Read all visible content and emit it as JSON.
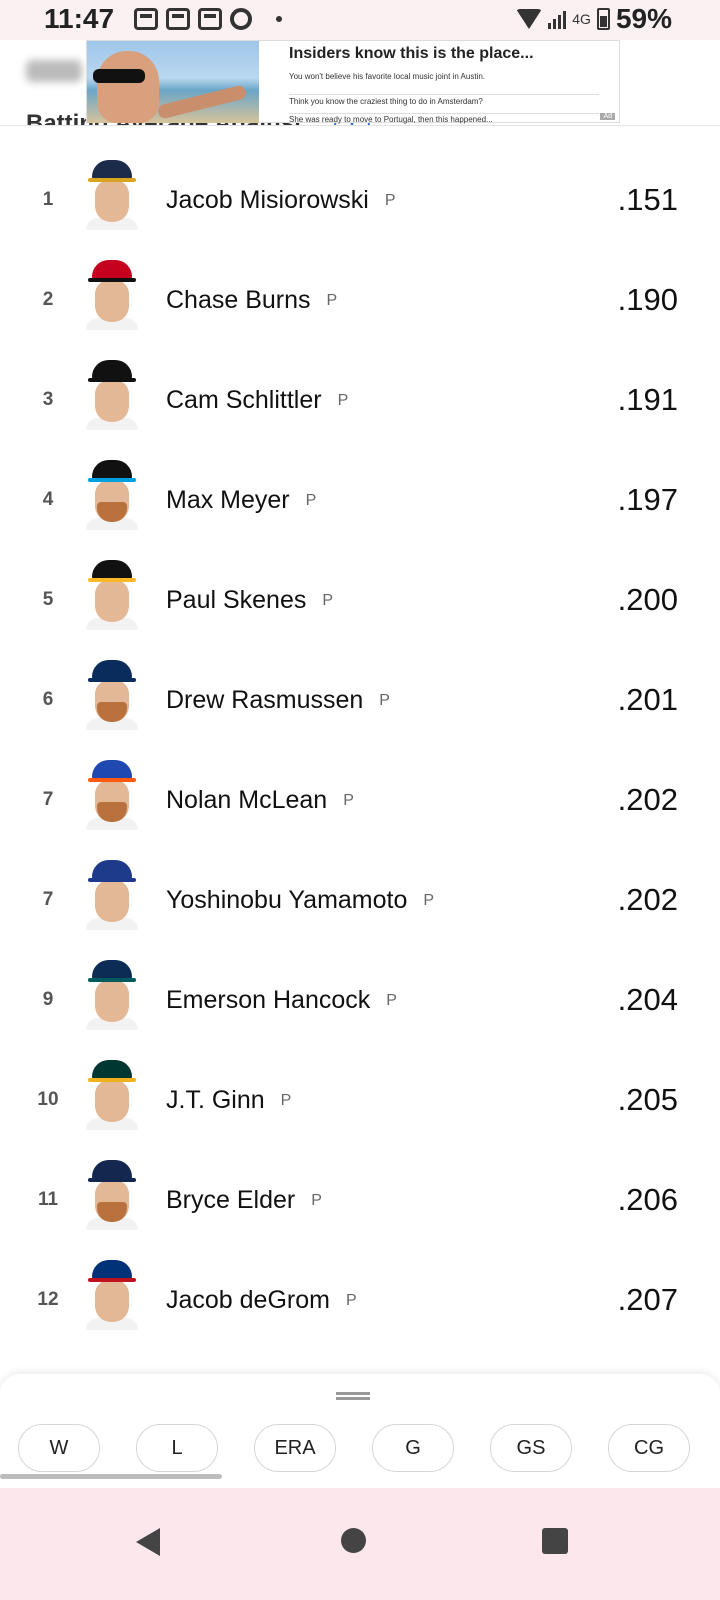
{
  "status_bar": {
    "time": "11:47",
    "network": "4G",
    "battery": "59%"
  },
  "header": {
    "stat_title": "Batting Average Against"
  },
  "ad": {
    "title": "Insiders know this is the place...",
    "line1": "You won't believe his favorite local music joint in Austin.",
    "line2": "Think you know the craziest thing to do in Amsterdam?",
    "line3": "She was ready to move to Portugal, then this happened..."
  },
  "leaders": [
    {
      "rank": "1",
      "name": "Jacob Misiorowski",
      "position": "P",
      "value": ".151",
      "cap_color": "#1c2b4a",
      "brim_color": "#d9a520",
      "beard": false
    },
    {
      "rank": "2",
      "name": "Chase Burns",
      "position": "P",
      "value": ".190",
      "cap_color": "#c6011f",
      "brim_color": "#111111",
      "beard": false
    },
    {
      "rank": "3",
      "name": "Cam Schlittler",
      "position": "P",
      "value": ".191",
      "cap_color": "#111111",
      "brim_color": "#111111",
      "beard": false
    },
    {
      "rank": "4",
      "name": "Max Meyer",
      "position": "P",
      "value": ".197",
      "cap_color": "#111111",
      "brim_color": "#00a3e0",
      "beard": true
    },
    {
      "rank": "5",
      "name": "Paul Skenes",
      "position": "P",
      "value": ".200",
      "cap_color": "#111111",
      "brim_color": "#fdb827",
      "beard": false
    },
    {
      "rank": "6",
      "name": "Drew Rasmussen",
      "position": "P",
      "value": ".201",
      "cap_color": "#092c5c",
      "brim_color": "#092c5c",
      "beard": true
    },
    {
      "rank": "7",
      "name": "Nolan McLean",
      "position": "P",
      "value": ".202",
      "cap_color": "#1f48b0",
      "brim_color": "#ff5910",
      "beard": true
    },
    {
      "rank": "7",
      "name": "Yoshinobu Yamamoto",
      "position": "P",
      "value": ".202",
      "cap_color": "#1e3a8a",
      "brim_color": "#1e3a8a",
      "beard": false
    },
    {
      "rank": "9",
      "name": "Emerson Hancock",
      "position": "P",
      "value": ".204",
      "cap_color": "#0c2c56",
      "brim_color": "#005c5c",
      "beard": false
    },
    {
      "rank": "10",
      "name": "J.T. Ginn",
      "position": "P",
      "value": ".205",
      "cap_color": "#003831",
      "brim_color": "#efb21e",
      "beard": false
    },
    {
      "rank": "11",
      "name": "Bryce Elder",
      "position": "P",
      "value": ".206",
      "cap_color": "#13274f",
      "brim_color": "#13274f",
      "beard": true
    },
    {
      "rank": "12",
      "name": "Jacob deGrom",
      "position": "P",
      "value": ".207",
      "cap_color": "#003278",
      "brim_color": "#c0111f",
      "beard": false
    }
  ],
  "stat_tabs": [
    "W",
    "L",
    "ERA",
    "G",
    "GS",
    "CG"
  ]
}
